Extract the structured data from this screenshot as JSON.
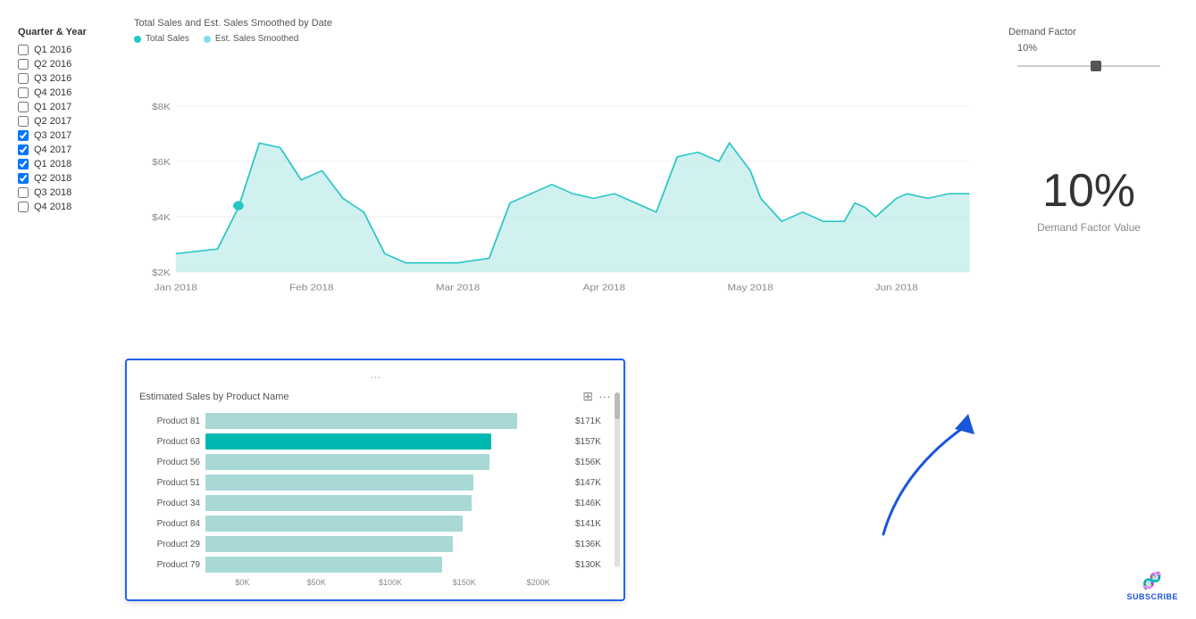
{
  "sidebar": {
    "title": "Quarter & Year",
    "items": [
      {
        "label": "Q1 2016",
        "checked": false
      },
      {
        "label": "Q2 2016",
        "checked": false
      },
      {
        "label": "Q3 2016",
        "checked": false
      },
      {
        "label": "Q4 2016",
        "checked": false
      },
      {
        "label": "Q1 2017",
        "checked": false
      },
      {
        "label": "Q2 2017",
        "checked": false
      },
      {
        "label": "Q3 2017",
        "checked": true
      },
      {
        "label": "Q4 2017",
        "checked": true
      },
      {
        "label": "Q1 2018",
        "checked": true
      },
      {
        "label": "Q2 2018",
        "checked": true
      },
      {
        "label": "Q3 2018",
        "checked": false
      },
      {
        "label": "Q4 2018",
        "checked": false
      }
    ]
  },
  "lineChart": {
    "title": "Total Sales and Est. Sales Smoothed by Date",
    "legend": [
      {
        "label": "Total Sales",
        "color": "#26c6c6"
      },
      {
        "label": "Est. Sales Smoothed",
        "color": "#80deea"
      }
    ],
    "xLabels": [
      "Jan 2018",
      "Feb 2018",
      "Mar 2018",
      "Apr 2018",
      "May 2018",
      "Jun 2018"
    ],
    "yLabels": [
      "$2K",
      "$4K",
      "$6K",
      "$8K"
    ]
  },
  "barChart": {
    "title": "Estimated Sales by Product Name",
    "products": [
      {
        "name": "Product 81",
        "value": 171,
        "label": "$171K",
        "highlight": false
      },
      {
        "name": "Product 63",
        "value": 157,
        "label": "$157K",
        "highlight": true
      },
      {
        "name": "Product 56",
        "value": 156,
        "label": "$156K",
        "highlight": false
      },
      {
        "name": "Product 51",
        "value": 147,
        "label": "$147K",
        "highlight": false
      },
      {
        "name": "Product 34",
        "value": 146,
        "label": "$146K",
        "highlight": false
      },
      {
        "name": "Product 84",
        "value": 141,
        "label": "$141K",
        "highlight": false
      },
      {
        "name": "Product 29",
        "value": 136,
        "label": "$136K",
        "highlight": false
      },
      {
        "name": "Product 79",
        "value": 130,
        "label": "$130K",
        "highlight": false
      }
    ],
    "axisLabels": [
      "$0K",
      "$50K",
      "$100K",
      "$150K",
      "$200K"
    ],
    "maxValue": 200
  },
  "demandFactor": {
    "sectionLabel": "Demand Factor",
    "sliderValue": "10%",
    "bigValue": "10%",
    "valueLabel": "Demand Factor Value",
    "sliderPercent": 55
  },
  "subscribe": {
    "label": "SUBSCRIBE"
  }
}
